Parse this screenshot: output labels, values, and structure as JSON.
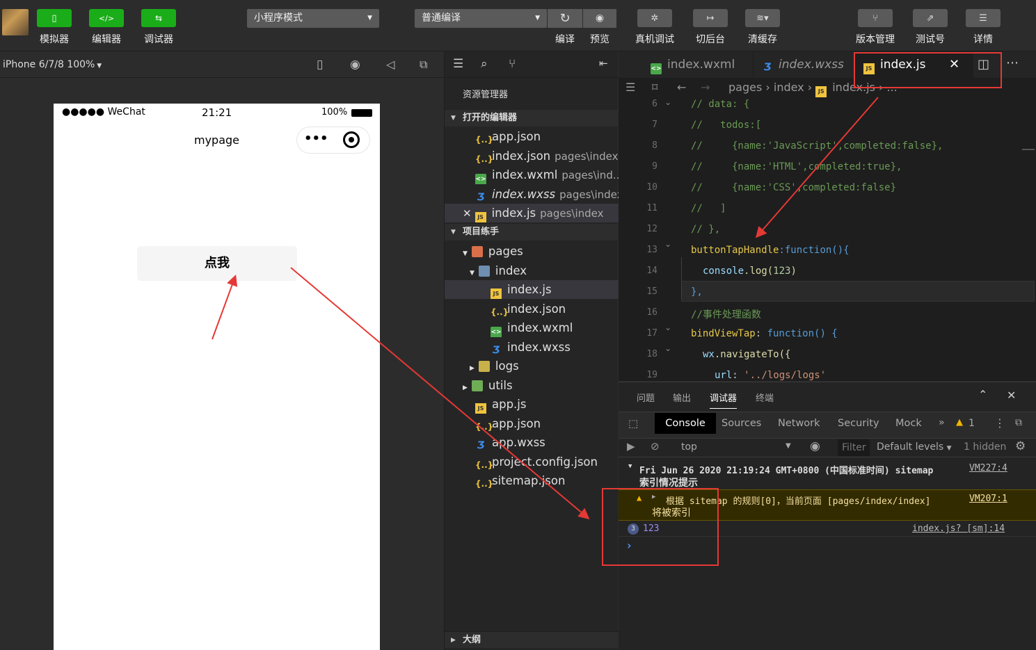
{
  "toolbar": {
    "left_buttons": [
      {
        "label": "模拟器"
      },
      {
        "label": "编辑器"
      },
      {
        "label": "调试器"
      }
    ],
    "mode_select": "小程序模式",
    "compile_select": "普通编译",
    "compile_label": "编译",
    "preview_label": "预览",
    "device_debug_label": "真机调试",
    "backend_label": "切后台",
    "cache_label": "清缓存",
    "version_label": "版本管理",
    "test_label": "测试号",
    "detail_label": "详情"
  },
  "simulator": {
    "device": "iPhone 6/7/8 100%",
    "status_carrier": "●●●●● WeChat",
    "status_time": "21:21",
    "status_battery": "100%",
    "nav_title": "mypage",
    "capsule_more": "•••",
    "button_label": "点我"
  },
  "explorer": {
    "header": "资源管理器",
    "open_editors_title": "打开的编辑器",
    "open_editors": [
      {
        "name": "app.json",
        "path": ""
      },
      {
        "name": "index.json",
        "path": "pages\\index"
      },
      {
        "name": "index.wxml",
        "path": "pages\\ind..."
      },
      {
        "name": "index.wxss",
        "path": "pages\\index"
      },
      {
        "name": "index.js",
        "path": "pages\\index"
      }
    ],
    "project_title": "项目练手",
    "tree": [
      {
        "name": "pages"
      },
      {
        "name": "index"
      },
      {
        "name": "index.js"
      },
      {
        "name": "index.json"
      },
      {
        "name": "index.wxml"
      },
      {
        "name": "index.wxss"
      },
      {
        "name": "logs"
      },
      {
        "name": "utils"
      },
      {
        "name": "app.js"
      },
      {
        "name": "app.json"
      },
      {
        "name": "app.wxss"
      },
      {
        "name": "project.config.json"
      },
      {
        "name": "sitemap.json"
      }
    ],
    "outline_title": "大纲"
  },
  "editor": {
    "tabs": [
      {
        "label": "index.wxml"
      },
      {
        "label": "index.wxss"
      },
      {
        "label": "index.js"
      }
    ],
    "breadcrumb": {
      "p1": "pages",
      "p2": "index",
      "p3": "index.js",
      "more": "..."
    },
    "line_numbers": [
      "6",
      "7",
      "8",
      "9",
      "10",
      "11",
      "12",
      "13",
      "14",
      "15",
      "16",
      "17",
      "18",
      "19"
    ],
    "lines": [
      "// data: {",
      "//   todos:[",
      "//     {name:'JavaScript',completed:false},",
      "//     {name:'HTML',completed:true},",
      "//     {name:'CSS',completed:false}",
      "//   ]",
      "// },",
      "buttonTapHandle",
      ":function(){",
      "console",
      ".log(",
      "123",
      ")",
      "},",
      "//事件处理函数",
      "bindViewTap",
      ": ",
      "function",
      "() {",
      "wx",
      ".navigateTo({",
      "url",
      ": ",
      "'../logs/logs'"
    ]
  },
  "panel": {
    "tabs": [
      {
        "label": "问题"
      },
      {
        "label": "输出"
      },
      {
        "label": "调试器"
      },
      {
        "label": "终端"
      }
    ],
    "devtabs": [
      {
        "label": "Console"
      },
      {
        "label": "Sources"
      },
      {
        "label": "Network"
      },
      {
        "label": "Security"
      },
      {
        "label": "Mock"
      }
    ],
    "warn_count": "1",
    "context": "top",
    "filter_placeholder": "Filter",
    "levels": "Default levels",
    "hidden": "1 hidden",
    "msg1_line1": "Fri Jun 26 2020 21:19:24 GMT+0800 (中国标准时间) sitemap",
    "msg1_line2": "索引情况提示",
    "msg1_src": "VM227:4",
    "msg2_line1": "根据 sitemap 的规则[0]，当前页面 [pages/index/index]",
    "msg2_line2": "将被索引",
    "msg2_src": "VM207:1",
    "log_count": "3",
    "log_value": "123",
    "log_src": "index.js? [sm]:14",
    "prompt": "›"
  },
  "colors": {
    "accent_green": "#1aad19",
    "highlight_red": "#e53935"
  }
}
